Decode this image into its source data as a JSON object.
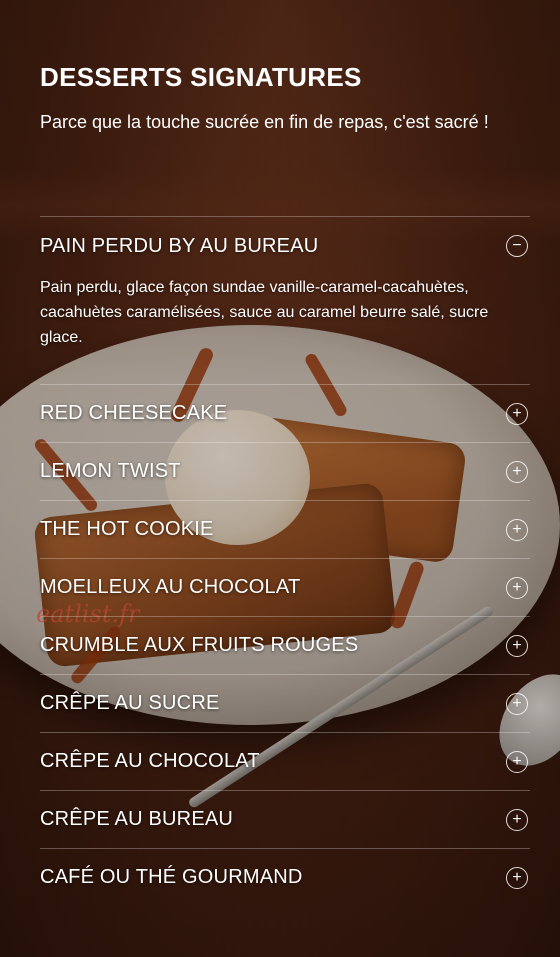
{
  "header": {
    "title": "DESSERTS SIGNATURES",
    "subtitle": "Parce que la touche sucrée en fin de repas, c'est sacré !"
  },
  "accordion": {
    "open_icon": "−",
    "closed_icon": "+",
    "items": [
      {
        "label": "PAIN PERDU BY AU BUREAU",
        "expanded": true,
        "description": "Pain perdu, glace façon sundae vanille-caramel-cacahuètes, cacahuètes caramélisées, sauce au caramel beurre salé, sucre glace."
      },
      {
        "label": "RED CHEESECAKE",
        "expanded": false
      },
      {
        "label": "LEMON TWIST",
        "expanded": false
      },
      {
        "label": "THE HOT COOKIE",
        "expanded": false
      },
      {
        "label": "MOELLEUX AU CHOCOLAT",
        "expanded": false
      },
      {
        "label": "CRUMBLE AUX FRUITS ROUGES",
        "expanded": false
      },
      {
        "label": "CRÊPE AU SUCRE",
        "expanded": false
      },
      {
        "label": "CRÊPE AU CHOCOLAT",
        "expanded": false
      },
      {
        "label": "CRÊPE AU BUREAU",
        "expanded": false
      },
      {
        "label": "CAFÉ OU THÉ GOURMAND",
        "expanded": false
      }
    ]
  },
  "watermark": "eatlist.fr",
  "colors": {
    "text": "#ffffff",
    "background": "#3a1e12",
    "divider": "rgba(255,255,255,0.28)",
    "watermark": "#be4632"
  }
}
